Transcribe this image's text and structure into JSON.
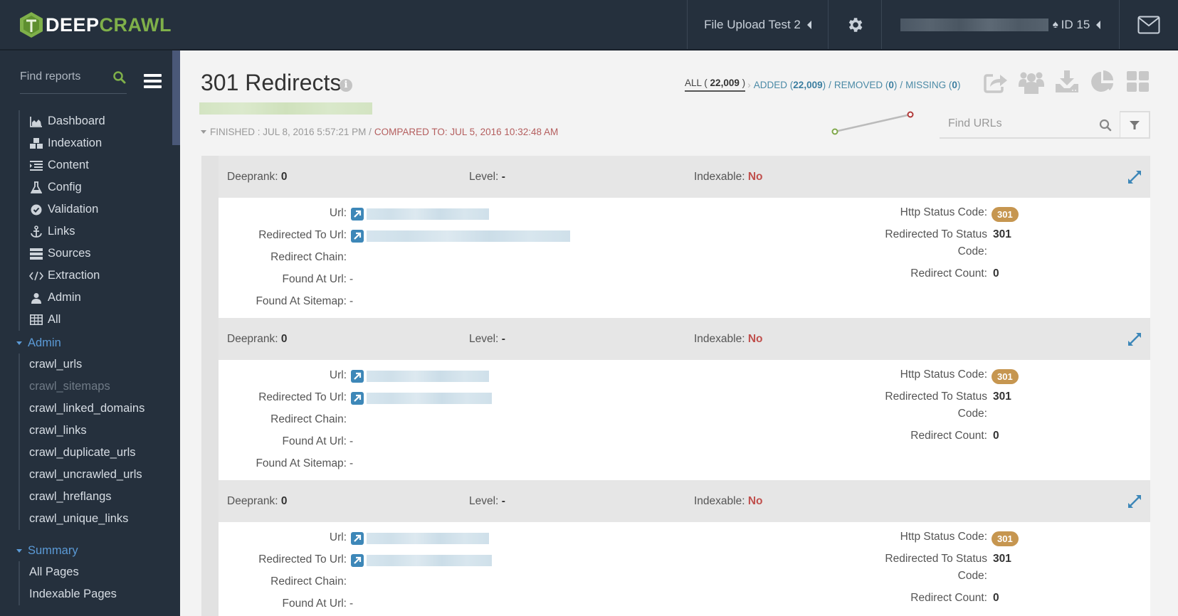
{
  "topbar": {
    "logo_part1": "DEEP",
    "logo_part2": "CRAWL",
    "project_name": "File Upload Test 2",
    "account_id": "ID 15",
    "icons": {
      "settings": "gear-icon",
      "messages": "envelope-icon",
      "account": "spade-icon"
    }
  },
  "sidebar": {
    "search_placeholder": "Find reports",
    "items": [
      {
        "label": "Dashboard",
        "icon": "area-chart-icon"
      },
      {
        "label": "Indexation",
        "icon": "cubes-icon"
      },
      {
        "label": "Content",
        "icon": "indent-icon"
      },
      {
        "label": "Config",
        "icon": "flask-icon"
      },
      {
        "label": "Validation",
        "icon": "check-circle-icon"
      },
      {
        "label": "Links",
        "icon": "anchor-icon"
      },
      {
        "label": "Sources",
        "icon": "server-icon"
      },
      {
        "label": "Extraction",
        "icon": "code-icon"
      },
      {
        "label": "Admin",
        "icon": "user-icon"
      },
      {
        "label": "All",
        "icon": "table-icon"
      }
    ],
    "admin_section": {
      "title": "Admin",
      "items": [
        {
          "label": "crawl_urls",
          "disabled": false
        },
        {
          "label": "crawl_sitemaps",
          "disabled": true
        },
        {
          "label": "crawl_linked_domains",
          "disabled": false
        },
        {
          "label": "crawl_links",
          "disabled": false
        },
        {
          "label": "crawl_duplicate_urls",
          "disabled": false
        },
        {
          "label": "crawl_uncrawled_urls",
          "disabled": false
        },
        {
          "label": "crawl_hreflangs",
          "disabled": false
        },
        {
          "label": "crawl_unique_links",
          "disabled": false
        }
      ]
    },
    "summary_section": {
      "title": "Summary",
      "items": [
        {
          "label": "All Pages"
        },
        {
          "label": "Indexable Pages"
        }
      ]
    }
  },
  "main": {
    "title": "301 Redirects",
    "finished": "FINISHED : JUL 8, 2016 5:57:21 PM /",
    "compared": "COMPARED TO: JUL 5, 2016 10:32:48 AM",
    "filters": {
      "all_label": "ALL (",
      "all_count": "22,009",
      "all_close": ")",
      "added_label": "ADDED (",
      "added_count": "22,009",
      "removed_label": "REMOVED (",
      "removed_count": "0",
      "missing_label": "MISSING (",
      "missing_count": "0",
      "close": ")",
      "separator": "/"
    },
    "toolbar_icons": [
      "share-icon",
      "users-icon",
      "download-icon",
      "pie-chart-icon",
      "grid-icon"
    ],
    "search_placeholder": "Find URLs",
    "trend": {
      "points": 2,
      "start_color": "#7fa84a",
      "end_color": "#b03a3a"
    },
    "labels": {
      "deeprank": "Deeprank:",
      "level": "Level:",
      "indexable": "Indexable:",
      "url": "Url:",
      "redirected_to_url": "Redirected To Url:",
      "redirect_chain": "Redirect Chain:",
      "found_at_url": "Found At Url:",
      "found_at_sitemap": "Found At Sitemap:",
      "http_status_code": "Http Status Code:",
      "redirected_to_status_line1": "Redirected To Status",
      "redirected_to_status_line2": "Code:",
      "redirect_count": "Redirect Count:"
    },
    "records": [
      {
        "deeprank": "0",
        "level": "-",
        "indexable": "No",
        "redirect_chain": "",
        "found_at_url": "-",
        "found_at_sitemap": "-",
        "http_status_code": "301",
        "redirected_to_status_code": "301",
        "redirect_count": "0"
      },
      {
        "deeprank": "0",
        "level": "-",
        "indexable": "No",
        "redirect_chain": "",
        "found_at_url": "-",
        "found_at_sitemap": "-",
        "http_status_code": "301",
        "redirected_to_status_code": "301",
        "redirect_count": "0"
      },
      {
        "deeprank": "0",
        "level": "-",
        "indexable": "No",
        "redirect_chain": "",
        "found_at_url": "-",
        "found_at_sitemap": "-",
        "http_status_code": "301",
        "redirected_to_status_code": "301",
        "redirect_count": "0"
      }
    ]
  },
  "colors": {
    "nav_bg": "#25303d",
    "brand_green": "#7fb04a",
    "link_blue": "#4b8aa6",
    "section_blue": "#5b9ad6",
    "status_badge": "#c69650",
    "negative_red": "#c0504d"
  }
}
